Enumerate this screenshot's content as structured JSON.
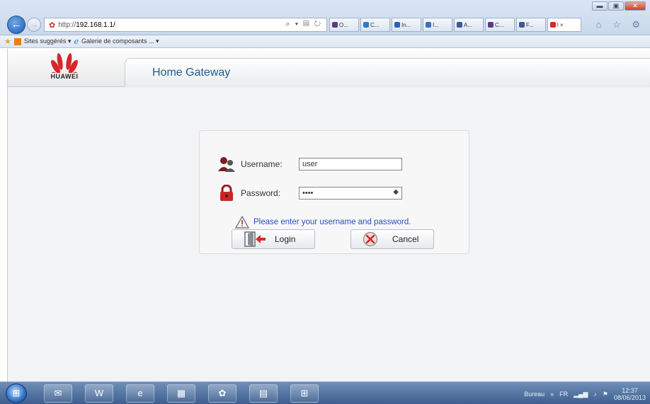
{
  "browser": {
    "url_prefix": "http://",
    "url_host": "192.168.1.1/",
    "address_icons": "⌕ ▾ ▤ ↻",
    "tabs": [
      {
        "label": "O...",
        "color": "#5b3a8a"
      },
      {
        "label": "C...",
        "color": "#2b79c9"
      },
      {
        "label": "In...",
        "color": "#2a62b5"
      },
      {
        "label": "I...",
        "color": "#3d6fb3"
      },
      {
        "label": "A...",
        "color": "#3b5998"
      },
      {
        "label": "C...",
        "color": "#5b3a8a"
      },
      {
        "label": "F...",
        "color": "#3b5998"
      },
      {
        "label": "l ×",
        "color": "#d7262b"
      }
    ],
    "nav_icons": "⌂ ☆ ⚙",
    "window_controls": {
      "minimize": "▬",
      "maximize": "▣",
      "close": "✕"
    },
    "favorites": {
      "suggested": "Sites suggérés ▾",
      "gallery": "Galerie de composants ... ▾"
    }
  },
  "header": {
    "brand": "HUAWEI",
    "title": "Home Gateway"
  },
  "login": {
    "username_label": "Username:",
    "username_value": "user",
    "password_label": "Password:",
    "password_value": "••••",
    "warning": "Please enter your username and password."
  },
  "buttons": {
    "login": "Login",
    "cancel": "Cancel"
  },
  "taskbar": {
    "apps": [
      "✉",
      "W",
      "e",
      "▦",
      "✿",
      "▤",
      "⊞"
    ],
    "tray_desktop": "Bureau",
    "tray_chevron": "»",
    "language": "FR",
    "time": "12:37",
    "date": "08/06/2013"
  }
}
